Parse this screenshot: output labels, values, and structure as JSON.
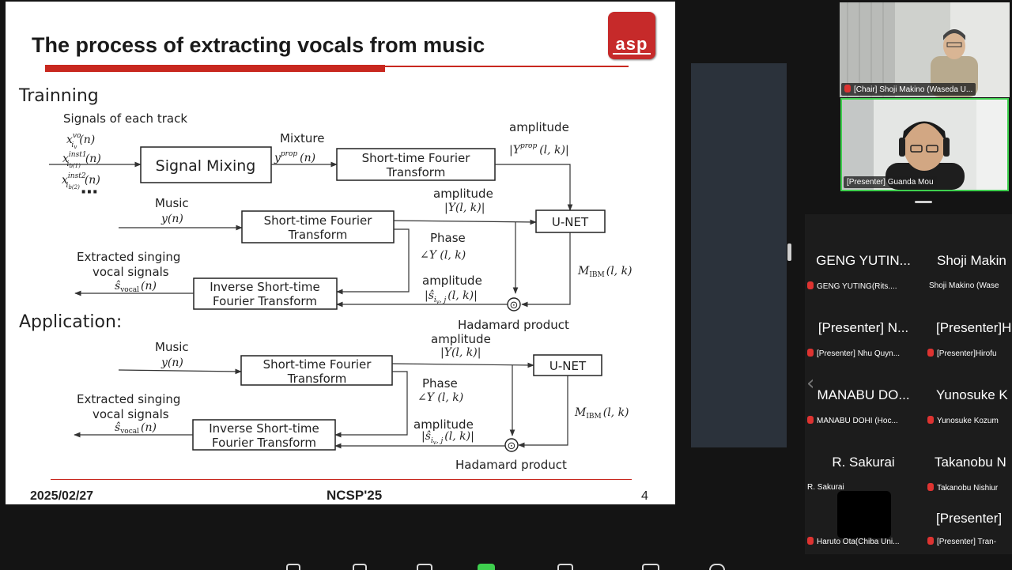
{
  "slide": {
    "title": "The process of extracting vocals from music",
    "logo_text": "asp",
    "training": {
      "label": "Trainning",
      "signals_label": "Signals of each track",
      "sig1": "x",
      "sig1_sup": "vo",
      "sig1_sub": "i",
      "sig1_sub2": "v",
      "sig1_arg": "(n)",
      "sig2": "x",
      "sig2_sup": "inst1",
      "sig2_sub": "i",
      "sig2_sub2": "b(1)",
      "sig2_arg": "(n)",
      "sig3": "x",
      "sig3_sup": "inst2",
      "sig3_sub": "i",
      "sig3_sub2": "b(2)",
      "sig3_arg": "(n)",
      "dots": "⋯",
      "signal_mixing": "Signal Mixing",
      "mixture": "Mixture",
      "mixture_sym": "y",
      "mixture_sup": "prop",
      "mixture_arg": "(n)",
      "stft1_line1": "Short-time Fourier",
      "stft1_line2": "Transform",
      "amp1": "amplitude",
      "amp1_sym": "|Y",
      "amp1_sup": "prop",
      "amp1_arg": "(l, k)|",
      "music": "Music",
      "music_sym": "y(n)",
      "stft2_line1": "Short-time Fourier",
      "stft2_line2": "Transform",
      "amp2": "amplitude",
      "amp2_sym": "|Y(l, k)|",
      "unet": "U-NET",
      "phase": "Phase",
      "phase_sym": "∠Y (l, k)",
      "mask_sym": "M",
      "mask_sub": "IBM",
      "mask_arg": "(l, k)",
      "extracted_line1": "Extracted singing",
      "extracted_line2": "vocal signals",
      "out_sym": "ŝ",
      "out_sub": "vocal",
      "out_arg": "(n)",
      "istft_line1": "Inverse Short-time",
      "istft_line2": "Fourier Transform",
      "amp3": "amplitude",
      "amp3_sym": "|ŝ",
      "amp3_sub": "i",
      "amp3_sub2": "v",
      "amp3_sub3": ", j",
      "amp3_arg": "(l, k)|",
      "hadamard_sym": "⊙",
      "hadamard": "Hadamard product"
    },
    "application": {
      "label": "Application:",
      "music": "Music",
      "music_sym": "y(n)",
      "amp1": "amplitude",
      "amp1_sym": "|Y(l, k)|",
      "stft_line1": "Short-time Fourier",
      "stft_line2": "Transform",
      "unet": "U-NET",
      "phase": "Phase",
      "phase_sym": "∠Y (l, k)",
      "mask_sym": "M",
      "mask_sub": "IBM",
      "mask_arg": "(l, k)",
      "extracted_line1": "Extracted singing",
      "extracted_line2": "vocal signals",
      "out_sym": "ŝ",
      "out_sub": "vocal",
      "out_arg": "(n)",
      "istft_line1": "Inverse Short-time",
      "istft_line2": "Fourier Transform",
      "amp2": "amplitude",
      "amp2_sym": "|ŝ",
      "amp2_sub": "i",
      "amp2_sub2": "v",
      "amp2_sub3": ", j",
      "amp2_arg": "(l, k)|",
      "hadamard_sym": "⊙",
      "hadamard": "Hadamard product"
    },
    "footer": {
      "date": "2025/02/27",
      "conference": "NCSP'25",
      "page": "4"
    }
  },
  "videos": [
    {
      "label": "[Chair] Shoji Makino  (Waseda U...",
      "muted": true
    },
    {
      "label": "[Presenter] Guanda Mou",
      "muted": false
    }
  ],
  "gallery": [
    {
      "name": "GENG YUTIN...",
      "sub": "GENG YUTING(Rits...."
    },
    {
      "name": "Shoji Makin",
      "sub": "Shoji Makino (Wase"
    },
    {
      "name": "[Presenter] N...",
      "sub": "[Presenter] Nhu Quyn..."
    },
    {
      "name": "[Presenter]H",
      "sub": "[Presenter]Hirofu"
    },
    {
      "name": "MANABU DO...",
      "sub": "MANABU DOHI (Hoc..."
    },
    {
      "name": "Yunosuke K",
      "sub": "Yunosuke Kozum"
    },
    {
      "name": "R. Sakurai",
      "sub": "R. Sakurai"
    },
    {
      "name": "Takanobu N",
      "sub": "Takanobu Nishiur"
    },
    {
      "name": "",
      "sub": "Haruto Ota(Chiba Uni..."
    },
    {
      "name": "[Presenter]",
      "sub": "[Presenter] Tran-"
    }
  ],
  "colors": {
    "accent_red": "#c8281f",
    "speaking_green": "#3ecf4e",
    "panel": "#2b323b"
  }
}
